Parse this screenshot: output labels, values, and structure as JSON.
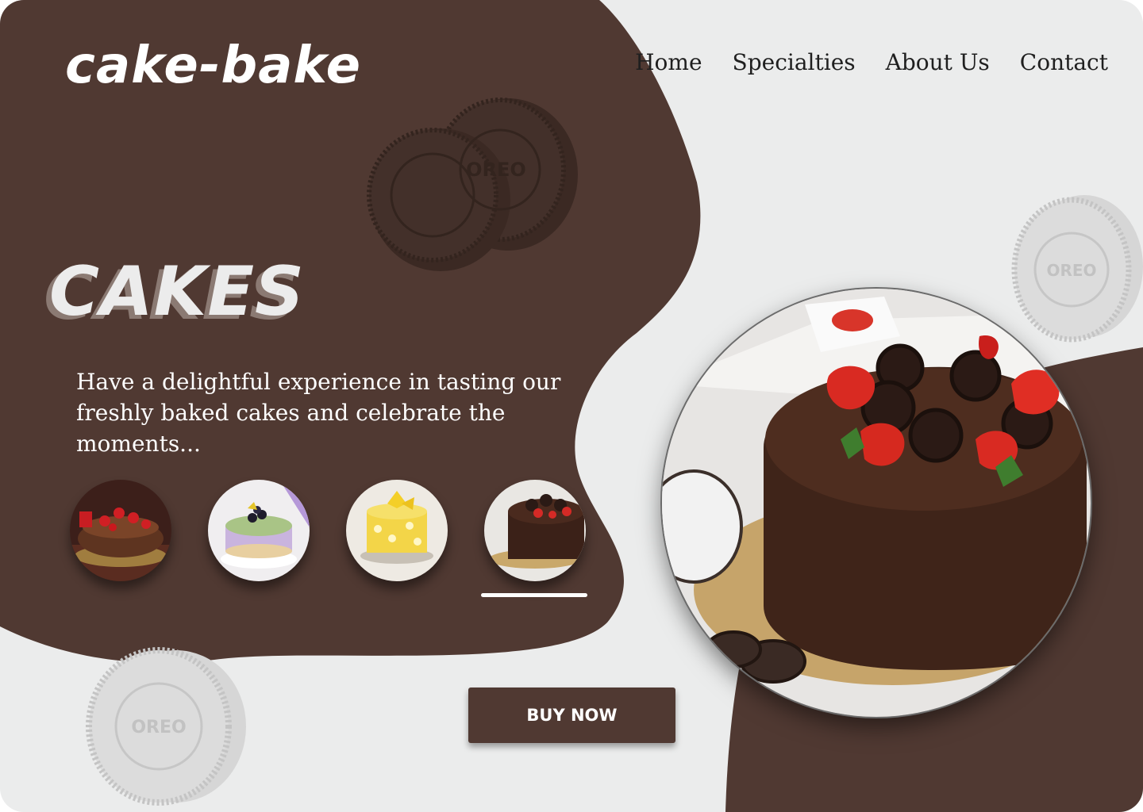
{
  "brand": {
    "logo": "cake-bake"
  },
  "nav": {
    "items": [
      "Home",
      "Specialties",
      "About Us",
      "Contact"
    ]
  },
  "hero": {
    "title": "CAKES",
    "description": "Have a delightful experience in tasting our freshly baked cakes and celebrate the moments..."
  },
  "thumbnails": {
    "items": [
      {
        "name": "chocolate-strawberry-cake"
      },
      {
        "name": "berry-cheesecake"
      },
      {
        "name": "yellow-flower-cake"
      },
      {
        "name": "oreo-chocolate-cake"
      }
    ],
    "active_index": 3
  },
  "cta": {
    "buy_now": "BUY NOW"
  },
  "colors": {
    "brown": "#503932",
    "background": "#ebecec",
    "text_light": "#ffffff",
    "nav_text": "#1f1f1f"
  },
  "cookie_text": "OREO"
}
